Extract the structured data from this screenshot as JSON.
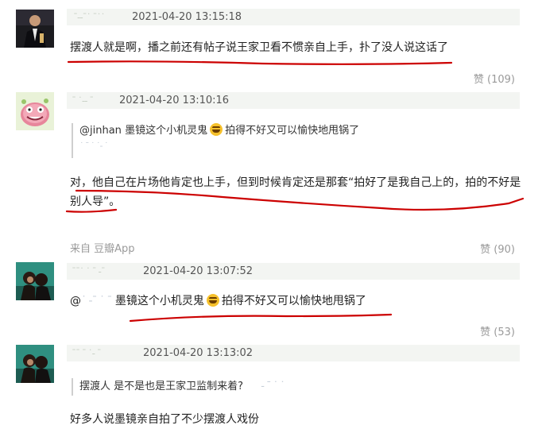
{
  "comments": [
    {
      "username": "ˉ-‐ˉ˙ ˉ˙˙",
      "time": "2021-04-20 13:15:18",
      "text": "摆渡人就是啊，播之前还有帖子说王家卫看不惯亲自上手，扑了没人说这话了",
      "vote": "赞 (109)"
    },
    {
      "username": "ˉ ˙-‐ ˉ",
      "time": "2021-04-20 13:10:16",
      "quote_user": "@jinhan",
      "quote_text_a": "墨镜这个小机灵鬼",
      "quote_text_b": "拍得不好又可以愉快地甩锅了",
      "quote_blur": "˙ ˉ ˙ ˙‐ ˙",
      "text_line1": "对，他自己在片场他肯定也上手，但到时候肯定还是那套“拍好了是我自己上的，拍的不好是",
      "text_line2": "别人导”。",
      "source": "来自 豆瓣App",
      "vote": "赞 (90)"
    },
    {
      "username": "ˉˉ˙ ˙ ˉ ‐ˉ",
      "time": "2021-04-20 13:07:52",
      "text_prefix": "@",
      "text_blur": "˙ ‐ˉ ˙ ˉ",
      "text_a": "墨镜这个小机灵鬼",
      "text_b": "拍得不好又可以愉快地甩锅了",
      "vote": "赞 (53)"
    },
    {
      "username": "ˉˉ ˉ ˙‐ ˉ",
      "time": "2021-04-20 13:13:02",
      "quote_text": "摆渡人 是不是也是王家卫监制来着?",
      "quote_blur": "‐ ˉ ˙ ˙",
      "text": "好多人说墨镜亲自拍了不少摆渡人戏份"
    }
  ],
  "colors": {
    "header_bg": "#f3f5f2",
    "annotation_red": "#cc0000",
    "vote_gray": "#9a9a9a"
  }
}
